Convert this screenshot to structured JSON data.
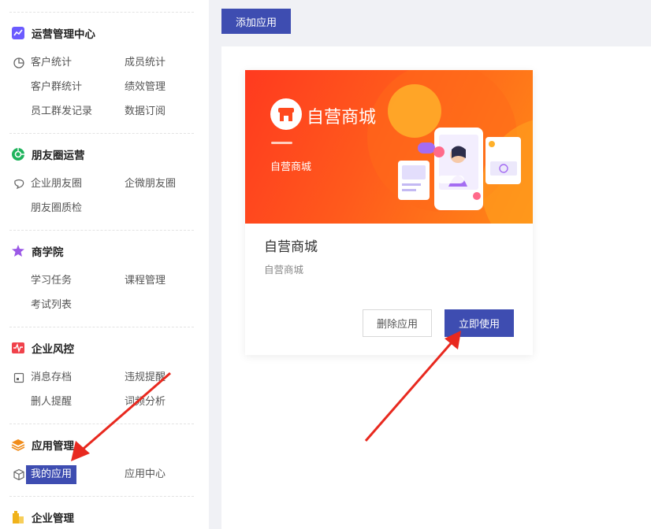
{
  "sidebar": {
    "sections": [
      {
        "title": "运营管理中心",
        "icon": "chart-trend-icon",
        "color": "#6b5bff",
        "items": [
          [
            "客户统计",
            "成员统计"
          ],
          [
            "客户群统计",
            "绩效管理"
          ],
          [
            "员工群发记录",
            "数据订阅"
          ]
        ],
        "item_icon": "pie-chart-icon"
      },
      {
        "title": "朋友圈运营",
        "icon": "moments-icon",
        "color": "#1fb35c",
        "items": [
          [
            "企业朋友圈",
            "企微朋友圈"
          ],
          [
            "朋友圈质检",
            ""
          ]
        ],
        "item_icon": "chat-bubble-icon"
      },
      {
        "title": "商学院",
        "icon": "school-icon",
        "color": "#9b59e6",
        "items": [
          [
            "学习任务",
            "课程管理"
          ],
          [
            "考试列表",
            ""
          ]
        ],
        "item_icon": ""
      },
      {
        "title": "企业风控",
        "icon": "risk-pulse-icon",
        "color": "#f0424b",
        "items": [
          [
            "消息存档",
            "违规提醒"
          ],
          [
            "删人提醒",
            "词频分析"
          ]
        ],
        "item_icon": "archive-icon"
      },
      {
        "title": "应用管理",
        "icon": "layers-icon",
        "color": "#f08c1a",
        "items": [
          [
            "我的应用",
            "应用中心"
          ]
        ],
        "item_icon": "cube-icon"
      },
      {
        "title": "企业管理",
        "icon": "building-icon",
        "color": "#f0b21a",
        "items": [],
        "item_icon": ""
      }
    ],
    "active_item": "我的应用"
  },
  "toolbar": {
    "add_app_label": "添加应用"
  },
  "app_card": {
    "banner_title": "自营商城",
    "banner_subtitle": "自营商城",
    "title": "自营商城",
    "description": "自营商城",
    "delete_label": "删除应用",
    "use_label": "立即使用"
  },
  "colors": {
    "primary": "#3e4db1",
    "banner_start": "#ff3a1f",
    "banner_end": "#ff8a17",
    "arrow": "#e8291f"
  }
}
